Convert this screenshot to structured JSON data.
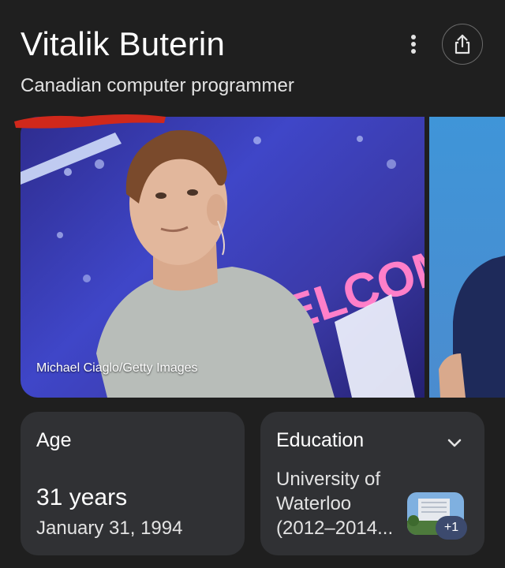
{
  "entity": {
    "name": "Vitalik Buterin",
    "description": "Canadian computer programmer"
  },
  "image": {
    "credit": "Michael Ciaglo/Getty Images",
    "background_text": "WELCOME TO"
  },
  "age_card": {
    "label": "Age",
    "value": "31 years",
    "date": "January 31, 1994"
  },
  "education_card": {
    "label": "Education",
    "lines": [
      "University of",
      "Waterloo",
      "(2012–2014..."
    ],
    "more_count": "+1"
  },
  "icons": {
    "more": "more-vert-icon",
    "share": "share-icon",
    "expand": "chevron-down-icon"
  },
  "colors": {
    "background": "#1f1f1f",
    "card": "#303134",
    "redaction": "#d0281b",
    "badge": "#3c4a6e"
  }
}
